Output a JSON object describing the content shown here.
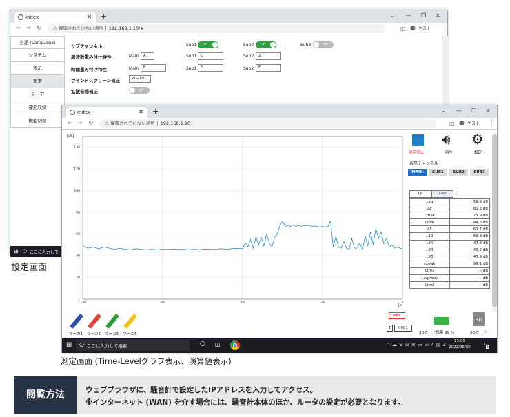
{
  "settings_window": {
    "tab_title": "index",
    "security_label": "保護されていない通信",
    "url": "192.168.1.10/#",
    "profile_label": "ゲスト",
    "sidebar": [
      "言語 (Language)",
      "システム",
      "表示",
      "測定",
      "ストア",
      "波形収録",
      "機能切替"
    ],
    "active_index": 3,
    "rows": {
      "subchannel": {
        "label": "サブチャンネル",
        "sub1": "Sub1",
        "sub2": "Sub2",
        "sub3": "Sub3",
        "on": "On",
        "off": "off"
      },
      "freq_weight": {
        "label": "周波数重み付け特性",
        "main": "Main",
        "main_val": "A",
        "sub1": "Sub1",
        "sub1_val": "C",
        "sub2": "Sub2",
        "sub2_val": "Z"
      },
      "time_weight": {
        "label": "時間重み付け特性",
        "main": "Main",
        "main_val": "F",
        "sub1": "Sub1",
        "sub1_val": "F",
        "sub2": "Sub2",
        "sub2_val": "F"
      },
      "windscreen": {
        "label": "ウインドスクリーン補正",
        "value": "WS-10"
      },
      "diffuse": {
        "label": "拡散音場補正",
        "off": "off"
      }
    },
    "taskbar_search": "ここに入力して"
  },
  "settings_caption": "設定画面",
  "measure_window": {
    "tab_title": "index",
    "security_label": "保護されていない通信",
    "url": "192.168.1.10",
    "profile_label": "ゲスト",
    "controls": {
      "stop": "測定停止",
      "play": "再生",
      "settings": "設定"
    },
    "channel_label": "表示チャンネル",
    "channels": [
      "MAIN",
      "SUB1",
      "SUB2",
      "SUB3"
    ],
    "selected_channel": "MAIN",
    "table_tabs": [
      "Lp",
      "Leq"
    ],
    "metrics": [
      {
        "name": "Leq",
        "value": "59.9 dB"
      },
      {
        "name": "LE",
        "value": "81.3 dB"
      },
      {
        "name": "Lmax",
        "value": "75.9 dB"
      },
      {
        "name": "Lmin",
        "value": "44.5 dB"
      },
      {
        "name": "L5",
        "value": "67.7 dB"
      },
      {
        "name": "L10",
        "value": "66.8 dB"
      },
      {
        "name": "L50",
        "value": "47.8 dB"
      },
      {
        "name": "L90",
        "value": "46.2 dB"
      },
      {
        "name": "L95",
        "value": "45.9 dB"
      },
      {
        "name": "Lpeak",
        "value": "99.1 dB"
      },
      {
        "name": "Ltm5",
        "value": "-.- dB"
      },
      {
        "name": "Leq,mov",
        "value": "-.- dB"
      },
      {
        "name": "Ltm5",
        "value": "-.- dB"
      }
    ],
    "rec_label": "REC",
    "counter_prefix": "T",
    "counter": "0001",
    "sd_remaining": "SDカード残量 99 %",
    "sd_label": "SDカード",
    "markers": [
      "マーカ1",
      "マーカ2",
      "マーカ3",
      "マーカ4"
    ],
    "marker_colors": [
      "#2a4fb0",
      "#e0413f",
      "#2f9a3a",
      "#f0c21d"
    ],
    "taskbar_search": "ここに入力して検索",
    "clock_time": "15:05",
    "clock_date": "2022/06/30",
    "notif_count": "5"
  },
  "chart_data": {
    "type": "line",
    "ylabel": "[dB]",
    "xlabel": "[s]",
    "ylim": [
      0,
      150
    ],
    "xlim": [
      -120,
      0
    ],
    "yticks": [
      "140",
      "120",
      "100",
      "80",
      "60",
      "40",
      "20"
    ],
    "xticks": [
      "-120",
      "-90",
      "-60",
      "-30",
      "0"
    ],
    "line_color": "#2b8fc6",
    "grid": true,
    "series_points": [
      [
        -120,
        49
      ],
      [
        -118,
        47
      ],
      [
        -116,
        48
      ],
      [
        -114,
        46.5
      ],
      [
        -112,
        48
      ],
      [
        -110,
        47
      ],
      [
        -108,
        46
      ],
      [
        -106,
        47
      ],
      [
        -104,
        46
      ],
      [
        -102,
        45.5
      ],
      [
        -100,
        46.5
      ],
      [
        -98,
        46
      ],
      [
        -96,
        45.5
      ],
      [
        -94,
        46
      ],
      [
        -92,
        45.5
      ],
      [
        -90,
        46
      ],
      [
        -88,
        45.8
      ],
      [
        -86,
        46.2
      ],
      [
        -84,
        45.8
      ],
      [
        -82,
        46
      ],
      [
        -80,
        45.6
      ],
      [
        -78,
        46
      ],
      [
        -76,
        45.7
      ],
      [
        -74,
        46.2
      ],
      [
        -72,
        45.8
      ],
      [
        -70,
        46
      ],
      [
        -68,
        46.5
      ],
      [
        -66,
        46
      ],
      [
        -64,
        46.5
      ],
      [
        -62,
        46.8
      ],
      [
        -60,
        46.5
      ],
      [
        -59,
        52
      ],
      [
        -58,
        48
      ],
      [
        -57,
        55
      ],
      [
        -56,
        47
      ],
      [
        -55,
        57
      ],
      [
        -54,
        50
      ],
      [
        -53,
        57
      ],
      [
        -52,
        49
      ],
      [
        -51,
        60
      ],
      [
        -50,
        52
      ],
      [
        -49,
        48
      ],
      [
        -48,
        57
      ],
      [
        -47,
        60
      ],
      [
        -46,
        68
      ],
      [
        -45,
        72
      ],
      [
        -44,
        67
      ],
      [
        -43,
        68
      ],
      [
        -42,
        67
      ],
      [
        -41,
        68.5
      ],
      [
        -40,
        67
      ],
      [
        -39,
        68
      ],
      [
        -38,
        67
      ],
      [
        -37,
        68
      ],
      [
        -36,
        67.5
      ],
      [
        -35,
        68
      ],
      [
        -34,
        67
      ],
      [
        -33,
        67.5
      ],
      [
        -32,
        67
      ],
      [
        -31,
        66.5
      ],
      [
        -30,
        67
      ],
      [
        -29,
        66.5
      ],
      [
        -28,
        67
      ],
      [
        -27,
        72
      ],
      [
        -26,
        48
      ],
      [
        -25,
        58
      ],
      [
        -24,
        48
      ],
      [
        -23,
        47
      ],
      [
        -22,
        53
      ],
      [
        -21,
        47
      ],
      [
        -20,
        46
      ],
      [
        -19,
        56
      ],
      [
        -18,
        47
      ],
      [
        -17,
        47
      ],
      [
        -16,
        52
      ],
      [
        -15,
        46
      ],
      [
        -14,
        58
      ],
      [
        -13,
        49
      ],
      [
        -12,
        62
      ],
      [
        -11,
        50
      ],
      [
        -10,
        65
      ],
      [
        -9,
        56
      ],
      [
        -8,
        62
      ],
      [
        -7,
        51
      ],
      [
        -6,
        56
      ],
      [
        -5,
        48
      ],
      [
        -4,
        50
      ],
      [
        -3,
        47
      ],
      [
        -2,
        48
      ],
      [
        -1,
        47
      ],
      [
        0,
        46.5
      ]
    ]
  },
  "measure_caption": "測定画面 (Time-Levelグラフ表示、演算値表示)",
  "banner": {
    "title": "閲覧方法",
    "line1": "ウェブブラウザに、騒音計で設定したIPアドレスを入力してアクセス。",
    "line2": "※インターネット (WAN) を介す場合には、騒音計本体のほか、ルータの設定が必要となります。"
  }
}
